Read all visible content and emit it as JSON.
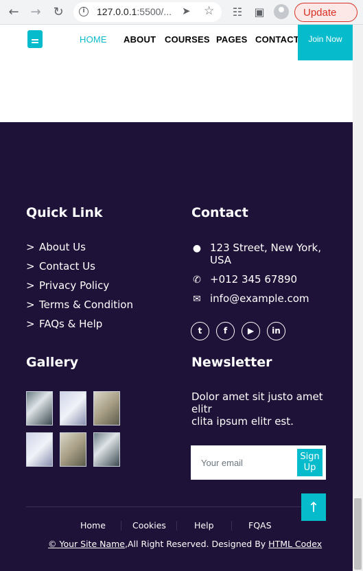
{
  "browser": {
    "url_host": "127.0.0.1",
    "url_rest": ":5500/...",
    "update_label": "Update"
  },
  "nav": {
    "links": [
      "HOME",
      "ABOUT",
      "COURSES",
      "PAGES",
      "CONTACT"
    ],
    "active": "HOME",
    "join_label": "Join Now"
  },
  "footer": {
    "quick_link_title": "Quick Link",
    "quick_links": [
      "About Us",
      "Contact Us",
      "Privacy Policy",
      "Terms & Condition",
      "FAQs & Help"
    ],
    "quick_link_marker": ">",
    "contact_title": "Contact",
    "address_line1": "123 Street, New York,",
    "address_line2": "USA",
    "phone": "+012 345 67890",
    "email": "info@example.com",
    "gallery_title": "Gallery",
    "newsletter_title": "Newsletter",
    "newsletter_line1": "Dolor amet sit justo amet",
    "newsletter_line2": "elitr",
    "newsletter_line3": "clita ipsum elitr est.",
    "email_placeholder": "Your email",
    "signup_label_1": "Sign",
    "signup_label_2": "Up",
    "bottom_links": [
      "Home",
      "Cookies",
      "Help",
      "FQAS"
    ],
    "copyright_prefix": "© ",
    "site_name": "Your Site Name",
    "copyright_mid": ",All Right Reserved. Designed By ",
    "designer": "HTML Codex"
  },
  "colors": {
    "accent": "#06bbcc",
    "footer_bg": "#1f1238"
  }
}
